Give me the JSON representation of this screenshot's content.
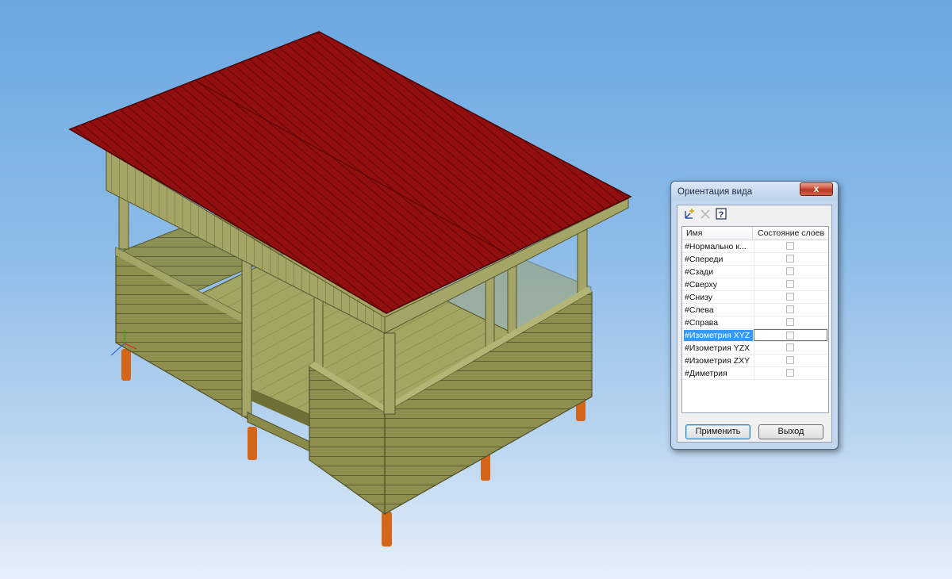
{
  "dialog": {
    "title": "Ориентация вида",
    "close_symbol": "x",
    "toolbar": {
      "icons": [
        "add-view-icon",
        "delete-icon",
        "help-icon"
      ]
    },
    "columns": {
      "name": "Имя",
      "layer_state": "Состояние слоев"
    },
    "rows": [
      {
        "name": "#Нормально к...",
        "checked": false
      },
      {
        "name": "#Спереди",
        "checked": false
      },
      {
        "name": "#Сзади",
        "checked": false
      },
      {
        "name": "#Сверху",
        "checked": false
      },
      {
        "name": "#Снизу",
        "checked": false
      },
      {
        "name": "#Слева",
        "checked": false
      },
      {
        "name": "#Справа",
        "checked": false
      },
      {
        "name": "#Изометрия XYZ",
        "checked": false,
        "selected": true
      },
      {
        "name": "#Изометрия YZX",
        "checked": false
      },
      {
        "name": "#Изометрия ZXY",
        "checked": false
      },
      {
        "name": "#Диметрия",
        "checked": false
      }
    ],
    "buttons": {
      "apply": "Применить",
      "exit": "Выход"
    }
  },
  "colors": {
    "roof": "#8b0d0d",
    "wood": "#8d8e4e",
    "piles": "#d4661c",
    "background_top": "#6aa7e1",
    "background_bottom": "#e6eff9",
    "selection": "#3399ff"
  }
}
